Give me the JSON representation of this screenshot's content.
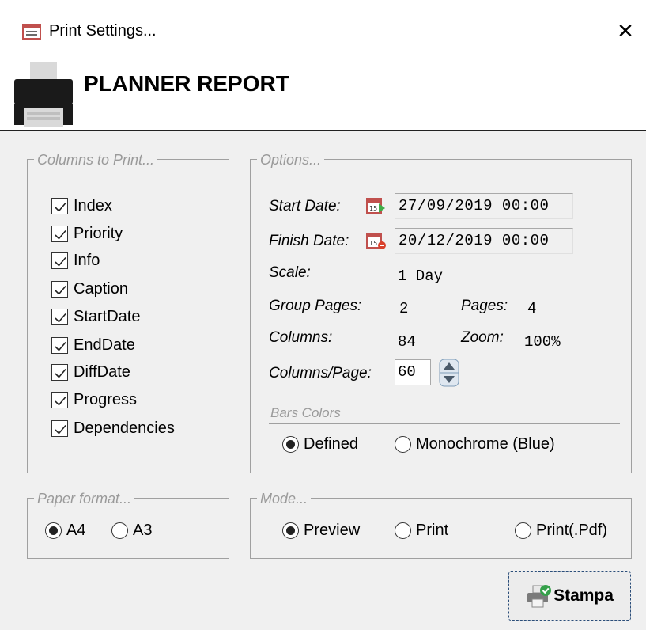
{
  "window": {
    "title": "Print Settings...",
    "close_label": "✕"
  },
  "header": {
    "title": "PLANNER REPORT",
    "printer_icon": "printer-icon"
  },
  "columns_group": {
    "legend": "Columns to Print...",
    "items": [
      {
        "label": "Index",
        "checked": true
      },
      {
        "label": "Priority",
        "checked": true
      },
      {
        "label": "Info",
        "checked": true
      },
      {
        "label": "Caption",
        "checked": true
      },
      {
        "label": "StartDate",
        "checked": true
      },
      {
        "label": "EndDate",
        "checked": true
      },
      {
        "label": "DiffDate",
        "checked": true
      },
      {
        "label": "Progress",
        "checked": true
      },
      {
        "label": "Dependencies",
        "checked": true
      }
    ]
  },
  "options_group": {
    "legend": "Options...",
    "start_date_label": "Start Date:",
    "start_date_value": "27/09/2019 00:00",
    "finish_date_label": "Finish Date:",
    "finish_date_value": "20/12/2019 00:00",
    "scale_label": "Scale:",
    "scale_value": "1 Day",
    "group_pages_label": "Group Pages:",
    "group_pages_value": "2",
    "pages_label": "Pages:",
    "pages_value": "4",
    "columns_label": "Columns:",
    "columns_value": "84",
    "zoom_label": "Zoom:",
    "zoom_value": "100%",
    "columns_page_label": "Columns/Page:",
    "columns_page_value": "60",
    "bars_colors_label": "Bars Colors",
    "bars_colors_options": [
      {
        "label": "Defined",
        "selected": true
      },
      {
        "label": "Monochrome (Blue)",
        "selected": false
      }
    ]
  },
  "paper_group": {
    "legend": "Paper format...",
    "options": [
      {
        "label": "A4",
        "selected": true
      },
      {
        "label": "A3",
        "selected": false
      }
    ]
  },
  "mode_group": {
    "legend": "Mode...",
    "options": [
      {
        "label": "Preview",
        "selected": true
      },
      {
        "label": "Print",
        "selected": false
      },
      {
        "label": "Print(.Pdf)",
        "selected": false
      }
    ]
  },
  "stampa_button": {
    "label": "Stampa",
    "icon": "print-check-icon"
  },
  "colors": {
    "accent_border": "#2b4e7a",
    "group_border": "#a0a0a0",
    "legend_text": "#9a9a9a"
  }
}
